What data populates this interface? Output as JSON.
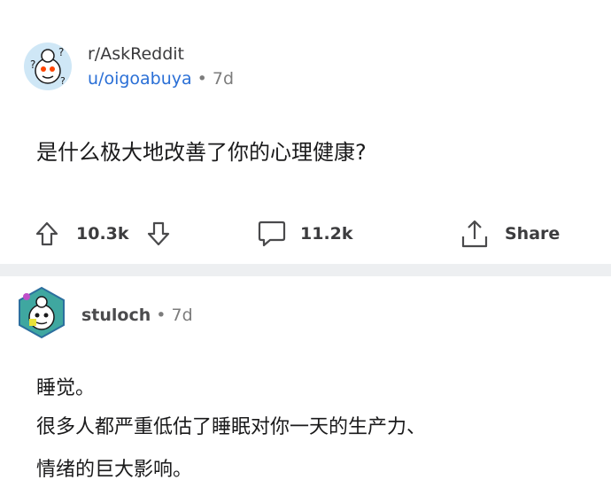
{
  "post": {
    "subreddit": "r/AskReddit",
    "username": "u/oigoabuya",
    "separator": "•",
    "age": "7d",
    "title": "是什么极大地改善了你的心理健康?",
    "upvotes": "10.3k",
    "comments": "11.2k",
    "share_label": "Share"
  },
  "comment": {
    "username": "stuloch",
    "separator": "•",
    "age": "7d",
    "lines": [
      "睡觉。",
      "很多人都严重低估了睡眠对你一天的生产力、",
      "情绪的巨大影响。"
    ]
  },
  "colors": {
    "username_blue": "#2a6fd6",
    "divider_gray": "#edeff1",
    "icon_gray": "#4a4a4c",
    "avatar_teal": "#3fa7a0"
  }
}
